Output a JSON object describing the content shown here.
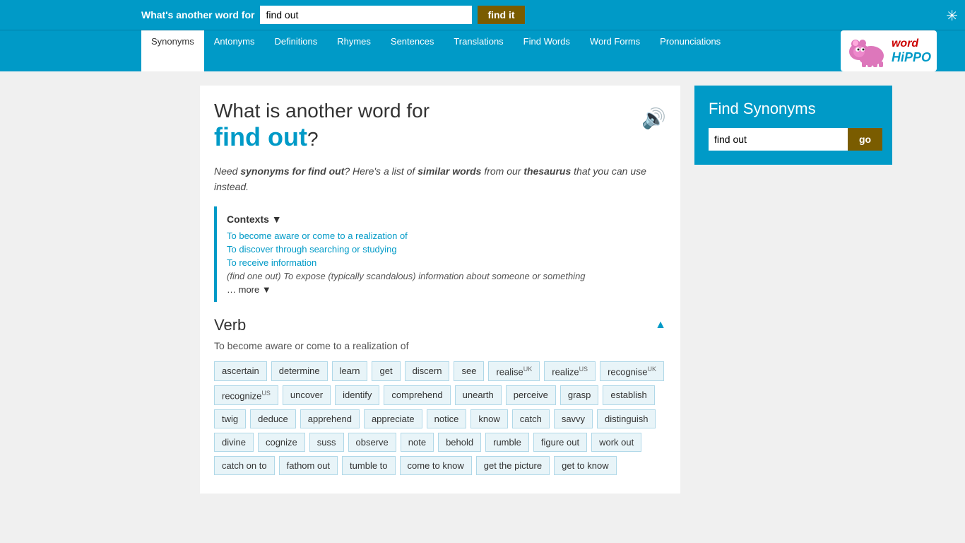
{
  "topbar": {
    "label": "What's another word for",
    "input_value": "find out",
    "button_label": "find it"
  },
  "nav": {
    "tabs": [
      {
        "label": "Synonyms",
        "active": true
      },
      {
        "label": "Antonyms",
        "active": false
      },
      {
        "label": "Definitions",
        "active": false
      },
      {
        "label": "Rhymes",
        "active": false
      },
      {
        "label": "Sentences",
        "active": false
      },
      {
        "label": "Translations",
        "active": false
      },
      {
        "label": "Find Words",
        "active": false
      },
      {
        "label": "Word Forms",
        "active": false
      },
      {
        "label": "Pronunciations",
        "active": false
      }
    ]
  },
  "heading": {
    "prefix": "What is another word for",
    "word": "find out",
    "suffix": "?"
  },
  "description": {
    "text_before": "Need ",
    "bold1": "synonyms for find out",
    "text_middle": "? Here's a list of ",
    "bold2": "similar words",
    "text_after": " from our ",
    "bold3": "thesaurus",
    "text_end": " that you can use instead."
  },
  "contexts": {
    "title": "Contexts ▼",
    "items": [
      "To become aware or come to a realization of",
      "To discover through searching or studying",
      "To receive information"
    ],
    "note_prefix": "(find one out)",
    "note_text": " To expose (typically scandalous) information about someone or something",
    "more_text": "… more ▼"
  },
  "verb_section": {
    "title": "Verb",
    "description": "To become aware or come to a realization of",
    "arrow": "▲",
    "tags": [
      {
        "word": "ascertain",
        "sup": ""
      },
      {
        "word": "determine",
        "sup": ""
      },
      {
        "word": "learn",
        "sup": ""
      },
      {
        "word": "get",
        "sup": ""
      },
      {
        "word": "discern",
        "sup": ""
      },
      {
        "word": "see",
        "sup": ""
      },
      {
        "word": "realise",
        "sup": "UK"
      },
      {
        "word": "realize",
        "sup": "US"
      },
      {
        "word": "recognise",
        "sup": "UK"
      },
      {
        "word": "recognize",
        "sup": "US"
      },
      {
        "word": "uncover",
        "sup": ""
      },
      {
        "word": "identify",
        "sup": ""
      },
      {
        "word": "comprehend",
        "sup": ""
      },
      {
        "word": "unearth",
        "sup": ""
      },
      {
        "word": "perceive",
        "sup": ""
      },
      {
        "word": "grasp",
        "sup": ""
      },
      {
        "word": "establish",
        "sup": ""
      },
      {
        "word": "twig",
        "sup": ""
      },
      {
        "word": "deduce",
        "sup": ""
      },
      {
        "word": "apprehend",
        "sup": ""
      },
      {
        "word": "appreciate",
        "sup": ""
      },
      {
        "word": "notice",
        "sup": ""
      },
      {
        "word": "know",
        "sup": ""
      },
      {
        "word": "catch",
        "sup": ""
      },
      {
        "word": "savvy",
        "sup": ""
      },
      {
        "word": "distinguish",
        "sup": ""
      },
      {
        "word": "divine",
        "sup": ""
      },
      {
        "word": "cognize",
        "sup": ""
      },
      {
        "word": "suss",
        "sup": ""
      },
      {
        "word": "observe",
        "sup": ""
      },
      {
        "word": "note",
        "sup": ""
      },
      {
        "word": "behold",
        "sup": ""
      },
      {
        "word": "rumble",
        "sup": ""
      },
      {
        "word": "figure out",
        "sup": ""
      },
      {
        "word": "work out",
        "sup": ""
      },
      {
        "word": "catch on to",
        "sup": ""
      },
      {
        "word": "fathom out",
        "sup": ""
      },
      {
        "word": "tumble to",
        "sup": ""
      },
      {
        "word": "come to know",
        "sup": ""
      },
      {
        "word": "get the picture",
        "sup": ""
      },
      {
        "word": "get to know",
        "sup": ""
      }
    ]
  },
  "sidebar": {
    "title": "Find Synonyms",
    "input_value": "find out",
    "button_label": "go"
  },
  "logo": {
    "word": "word",
    "hippo": "HiPPO"
  }
}
